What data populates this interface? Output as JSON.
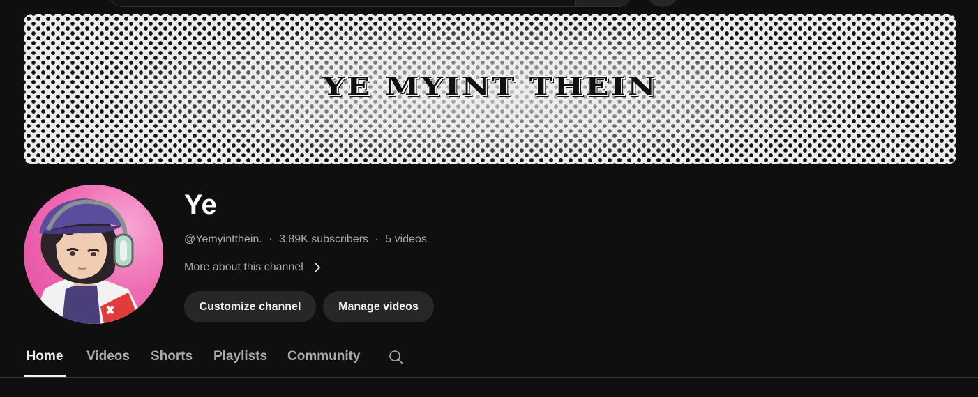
{
  "banner": {
    "title": "YE MYINT THEIN"
  },
  "channel": {
    "name": "Ye",
    "handle": "@Yemyintthein.",
    "separator": "·",
    "subscribers": "3.89K subscribers",
    "videos": "5 videos",
    "more_about": "More about this channel",
    "avatar_icon": "anime-avatar-with-headphones"
  },
  "actions": {
    "customize": "Customize channel",
    "manage": "Manage videos"
  },
  "tabs": [
    {
      "label": "Home",
      "active": true
    },
    {
      "label": "Videos",
      "active": false
    },
    {
      "label": "Shorts",
      "active": false
    },
    {
      "label": "Playlists",
      "active": false
    },
    {
      "label": "Community",
      "active": false
    }
  ],
  "icons": {
    "tab_search": "search-icon",
    "more_about": "chevron-right-icon"
  },
  "colors": {
    "background": "#0f0f0f",
    "text_primary": "#f1f1f1",
    "text_secondary": "#aaaaaa",
    "button_bg": "#272727",
    "avatar_bg": "#ef6cb3"
  }
}
